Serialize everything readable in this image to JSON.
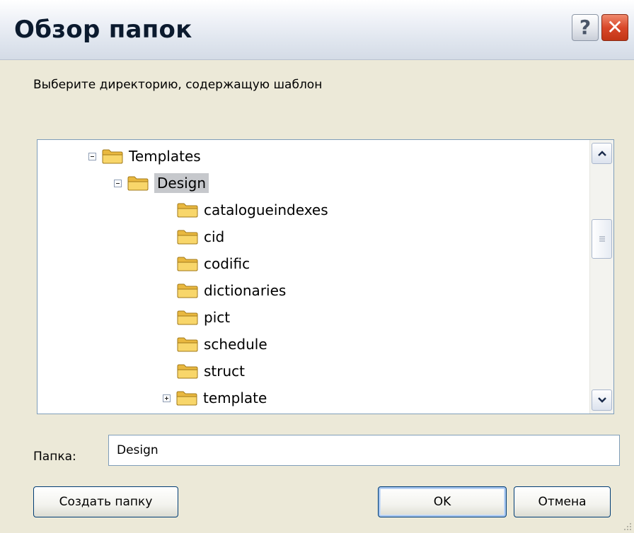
{
  "dialog": {
    "title": "Обзор папок",
    "help_symbol": "?",
    "close_symbol": "✕"
  },
  "instruction": "Выберите директорию, содержащую шаблон",
  "tree": {
    "items": [
      {
        "label": "Templates",
        "level": 0,
        "expander": "minus",
        "selected": false
      },
      {
        "label": "Design",
        "level": 1,
        "expander": "minus",
        "selected": true
      },
      {
        "label": "catalogueindexes",
        "level": 2,
        "expander": "none",
        "selected": false
      },
      {
        "label": "cid",
        "level": 2,
        "expander": "none",
        "selected": false
      },
      {
        "label": "codific",
        "level": 2,
        "expander": "none",
        "selected": false
      },
      {
        "label": "dictionaries",
        "level": 2,
        "expander": "none",
        "selected": false
      },
      {
        "label": "pict",
        "level": 2,
        "expander": "none",
        "selected": false
      },
      {
        "label": "schedule",
        "level": 2,
        "expander": "none",
        "selected": false
      },
      {
        "label": "struct",
        "level": 2,
        "expander": "none",
        "selected": false
      },
      {
        "label": "template",
        "level": 2,
        "expander": "plus",
        "selected": false
      }
    ],
    "icons": {
      "folder": "folder-icon",
      "scroll_up": "chevron-up-icon",
      "scroll_down": "chevron-down-icon"
    }
  },
  "folder_field": {
    "label": "Папка:",
    "value": "Design"
  },
  "buttons": {
    "create_folder": "Создать папку",
    "ok": "OK",
    "cancel": "Отмена"
  },
  "colors": {
    "dialog_bg": "#ece9d8",
    "close_red": "#d9482a",
    "selection_bg": "#c6c8cc",
    "folder_yellow": "#f5cf5c",
    "border_blue": "#7f9db9"
  }
}
